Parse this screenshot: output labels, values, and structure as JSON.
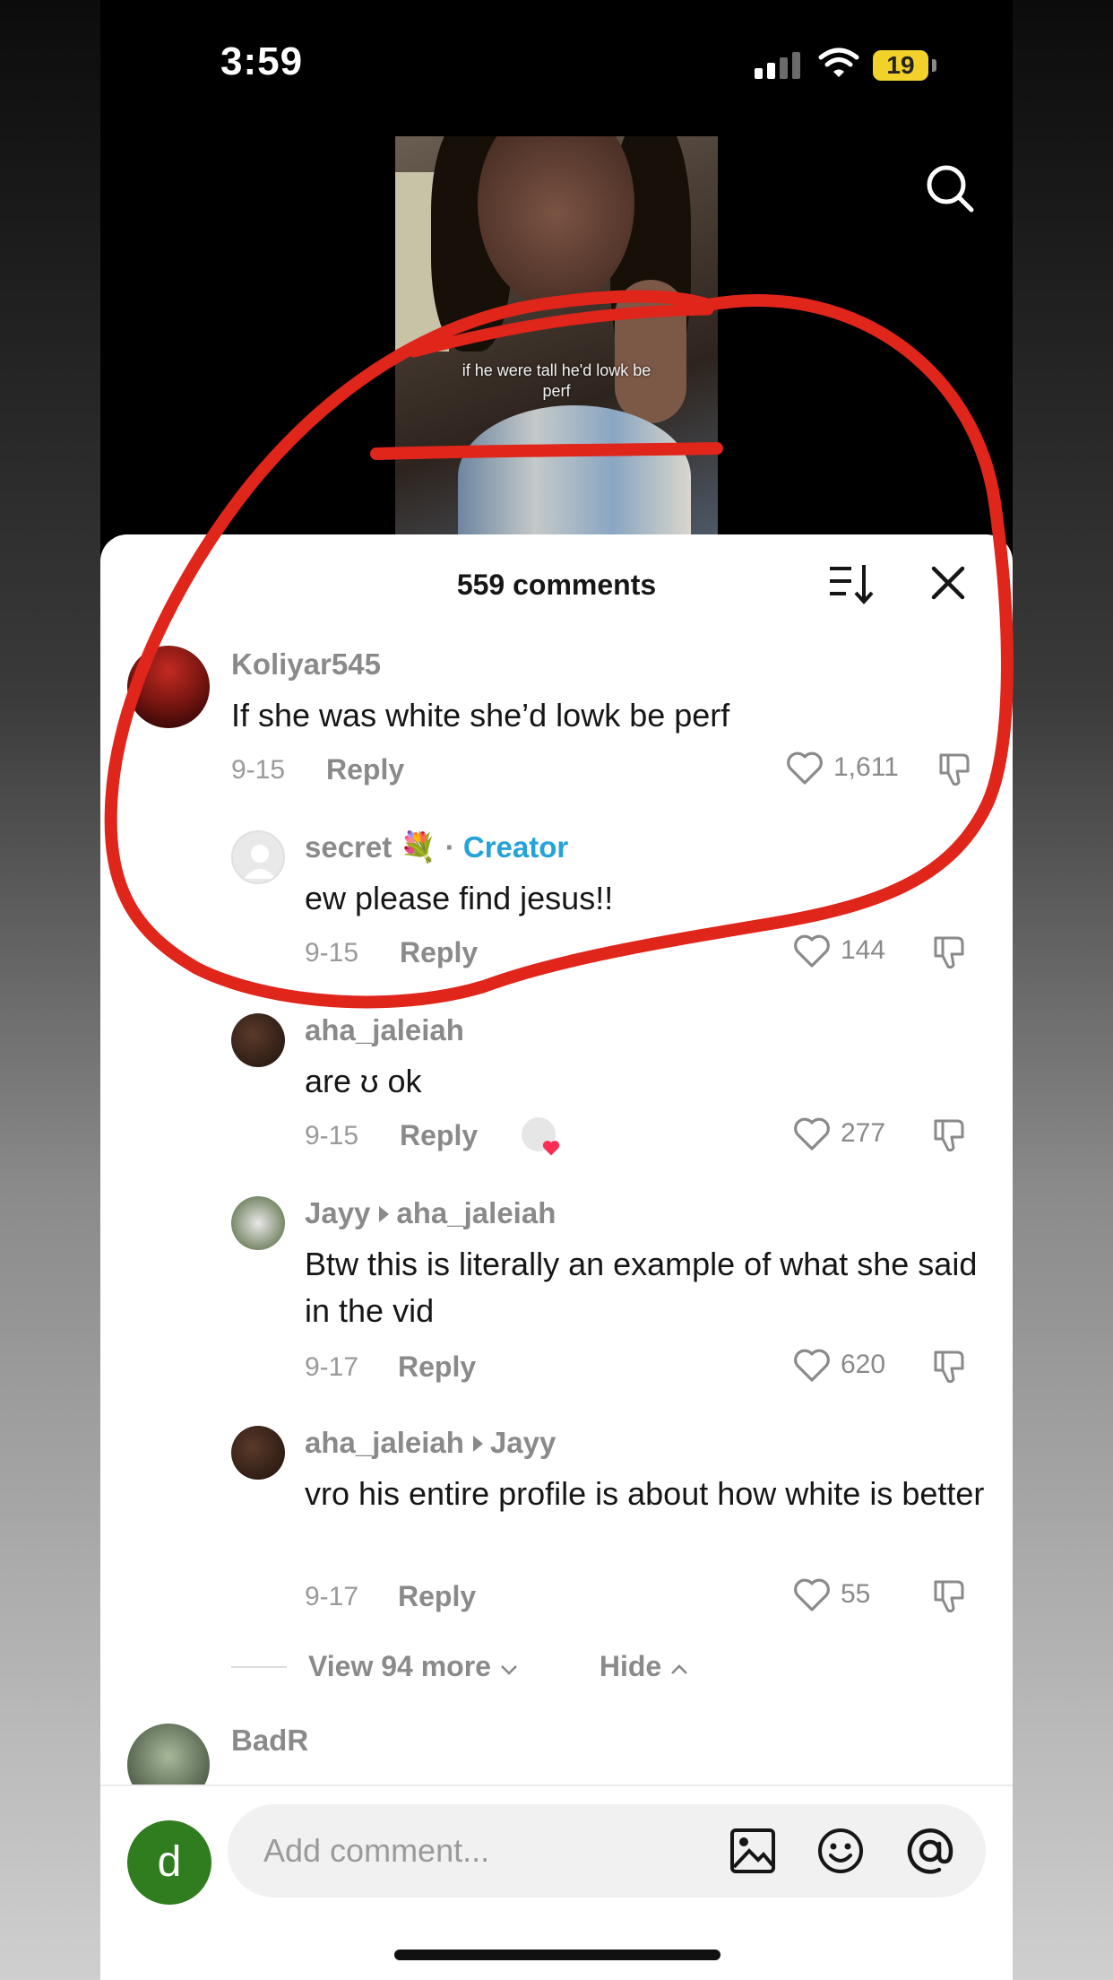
{
  "status_bar": {
    "time": "3:59",
    "battery": "19"
  },
  "video": {
    "caption": "if he were tall he'd lowk be perf"
  },
  "comments_header": {
    "title": "559 comments"
  },
  "comments": [
    {
      "user": "Koliyar545",
      "text": "If she was white she’d lowk be perf",
      "date": "9-15",
      "reply": "Reply",
      "likes": "1,611"
    },
    {
      "user": "secret",
      "emoji": "💐",
      "separator": "·",
      "tag": "Creator",
      "text": "ew please find jesus!!",
      "date": "9-15",
      "reply": "Reply",
      "likes": "144"
    },
    {
      "user": "aha_jaleiah",
      "text": "are ʊ ok",
      "date": "9-15",
      "reply": "Reply",
      "likes": "277"
    },
    {
      "user": "Jayy",
      "reply_to": "aha_jaleiah",
      "text": "Btw this is literally an example of what she said in the vid",
      "date": "9-17",
      "reply": "Reply",
      "likes": "620"
    },
    {
      "user": "aha_jaleiah",
      "reply_to": "Jayy",
      "text": "vro his entire profile is about how white is better",
      "date": "9-17",
      "reply": "Reply",
      "likes": "55"
    },
    {
      "user": "BadR"
    }
  ],
  "thread_controls": {
    "view_more": "View 94 more",
    "hide": "Hide"
  },
  "composer": {
    "avatar_letter": "d",
    "placeholder": "Add comment..."
  },
  "colors": {
    "annotation_red": "#e0251b",
    "creator_blue": "#25a3d9"
  }
}
